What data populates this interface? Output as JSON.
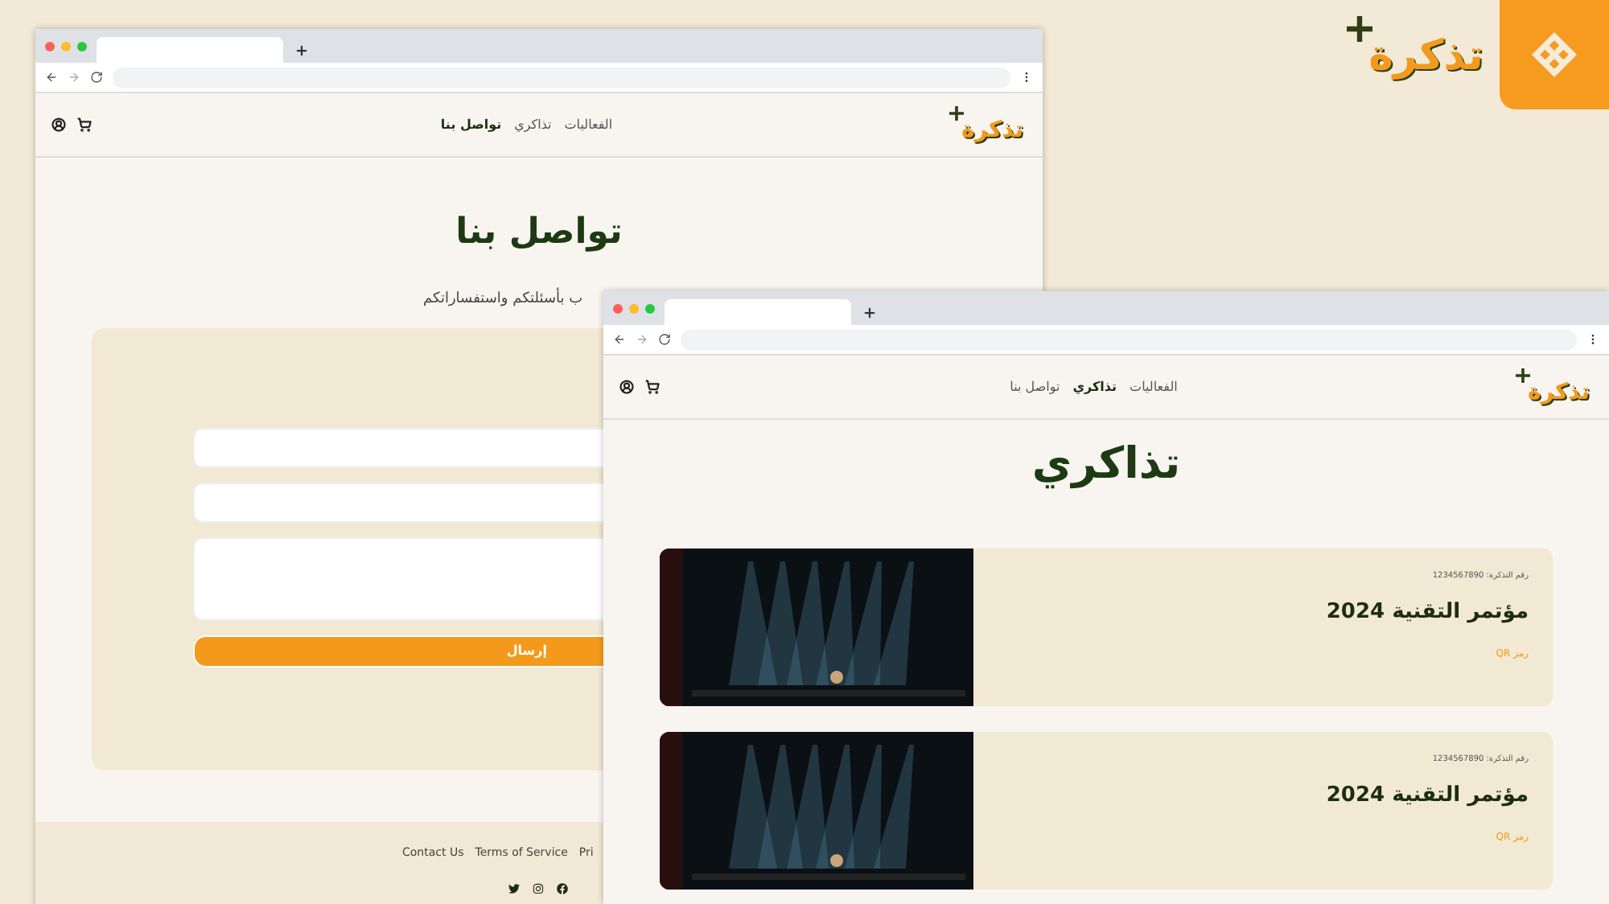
{
  "corner_logo": {
    "brand": "تذكرة"
  },
  "back_window": {
    "nav": {
      "brand": "تذكرة",
      "links": [
        {
          "label": "الفعاليات",
          "selected": false
        },
        {
          "label": "تذاكري",
          "selected": false
        },
        {
          "label": "تواصل بنا",
          "selected": true
        }
      ]
    },
    "title": "تواصل بنا",
    "subtitle": "ب بأسئلتكم واستفساراتكم",
    "submit": "إرسال",
    "footer": {
      "links": [
        "Pri",
        "Terms of Service",
        "Contact Us"
      ]
    }
  },
  "front_window": {
    "nav": {
      "brand": "تذكرة",
      "links": [
        {
          "label": "الفعاليات",
          "selected": false
        },
        {
          "label": "تذاكري",
          "selected": true
        },
        {
          "label": "تواصل بنا",
          "selected": false
        }
      ]
    },
    "title": "تذاكري",
    "tickets": [
      {
        "number": "رقم التذكرة: 1234567890",
        "title": "مؤتمر التقنية 2024",
        "qr_link": "رمز QR"
      },
      {
        "number": "رقم التذكرة: 1234567890",
        "title": "مؤتمر التقنية 2024",
        "qr_link": "رمز QR"
      }
    ]
  }
}
